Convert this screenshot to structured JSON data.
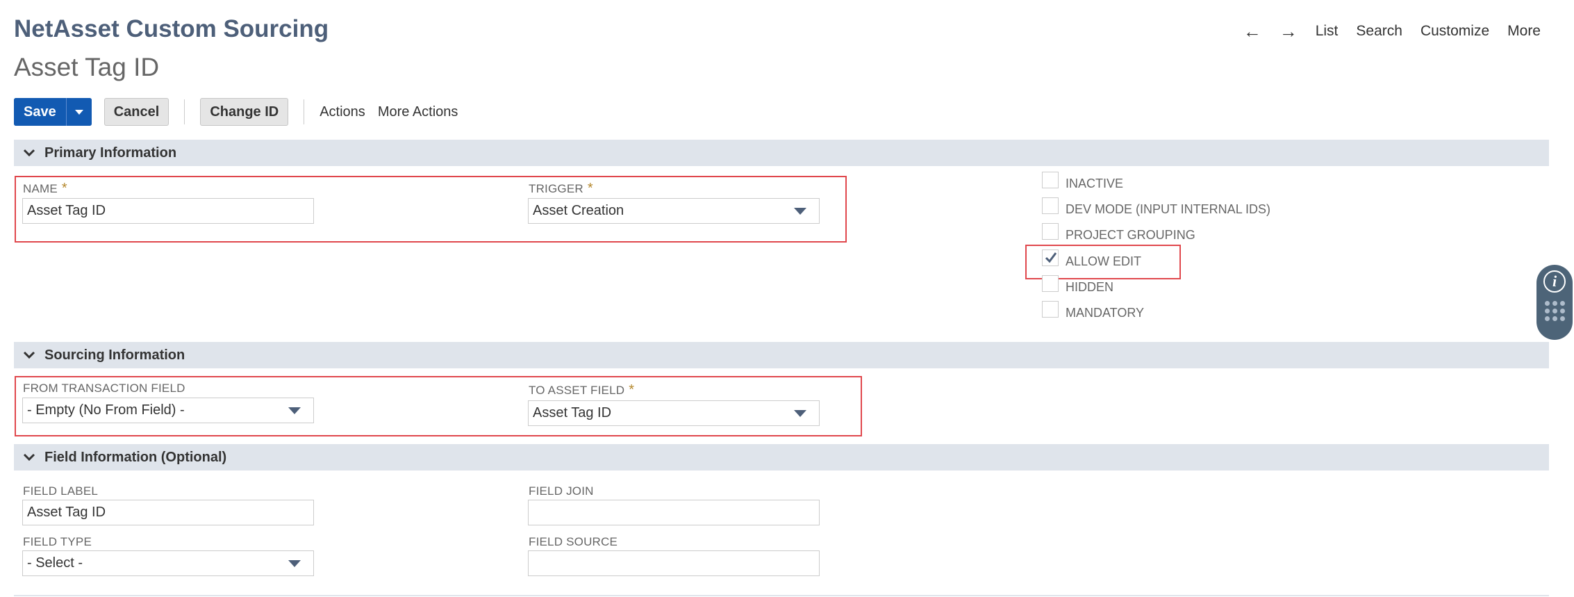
{
  "header": {
    "record_type": "NetAsset Custom Sourcing",
    "record_name": "Asset Tag ID"
  },
  "topnav": {
    "back_arrow": "←",
    "forward_arrow": "→",
    "list": "List",
    "search": "Search",
    "customize": "Customize",
    "more": "More"
  },
  "toolbar": {
    "save": "Save",
    "cancel": "Cancel",
    "change_id": "Change ID",
    "actions": "Actions",
    "more_actions": "More Actions"
  },
  "sections": {
    "primary": "Primary Information",
    "sourcing": "Sourcing Information",
    "field_info": "Field Information (Optional)"
  },
  "primary": {
    "name_label": "NAME",
    "name_value": "Asset Tag ID",
    "trigger_label": "TRIGGER",
    "trigger_value": "Asset Creation",
    "required_marker": "*",
    "checkboxes": [
      {
        "label": "INACTIVE",
        "checked": false
      },
      {
        "label": "DEV MODE (INPUT INTERNAL IDS)",
        "checked": false
      },
      {
        "label": "PROJECT GROUPING",
        "checked": false
      },
      {
        "label": "ALLOW EDIT",
        "checked": true
      },
      {
        "label": "HIDDEN",
        "checked": false
      },
      {
        "label": "MANDATORY",
        "checked": false
      }
    ]
  },
  "sourcing": {
    "from_label": "FROM TRANSACTION FIELD",
    "from_value": "- Empty (No From Field) -",
    "to_label": "TO ASSET FIELD",
    "to_value": "Asset Tag ID"
  },
  "field_info": {
    "field_label_label": "FIELD LABEL",
    "field_label_value": "Asset Tag ID",
    "field_join_label": "FIELD JOIN",
    "field_join_value": "",
    "field_type_label": "FIELD TYPE",
    "field_type_value": "- Select -",
    "field_source_label": "FIELD SOURCE",
    "field_source_value": ""
  },
  "colors": {
    "brand_title": "#4d5f79",
    "save_button": "#125ab2",
    "section_bar": "#dfe4eb",
    "highlight_box": "#e0474c",
    "required_star": "#b5892f"
  }
}
